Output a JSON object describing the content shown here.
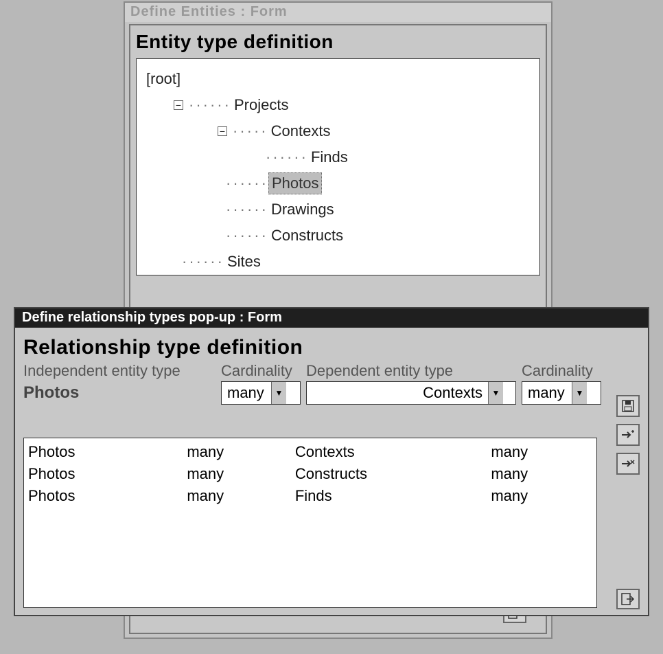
{
  "back_window": {
    "title": "Define Entities : Form",
    "heading": "Entity type definition",
    "tree": {
      "root_label": "[root]",
      "projects": "Projects",
      "contexts": "Contexts",
      "finds": "Finds",
      "photos": "Photos",
      "drawings": "Drawings",
      "constructs": "Constructs",
      "sites": "Sites",
      "selected": "Photos"
    }
  },
  "popup": {
    "title": "Define relationship types pop-up : Form",
    "heading": "Relationship type definition",
    "fields": {
      "independent_label": "Independent entity type",
      "independent_value": "Photos",
      "cardinality1_label": "Cardinality",
      "cardinality1_value": "many",
      "dependent_label": "Dependent entity type",
      "dependent_value": "Contexts",
      "cardinality2_label": "Cardinality",
      "cardinality2_value": "many"
    },
    "rows": [
      {
        "independent": "Photos",
        "card1": "many",
        "dependent": "Contexts",
        "card2": "many"
      },
      {
        "independent": "Photos",
        "card1": "many",
        "dependent": "Constructs",
        "card2": "many"
      },
      {
        "independent": "Photos",
        "card1": "many",
        "dependent": "Finds",
        "card2": "many"
      }
    ]
  }
}
